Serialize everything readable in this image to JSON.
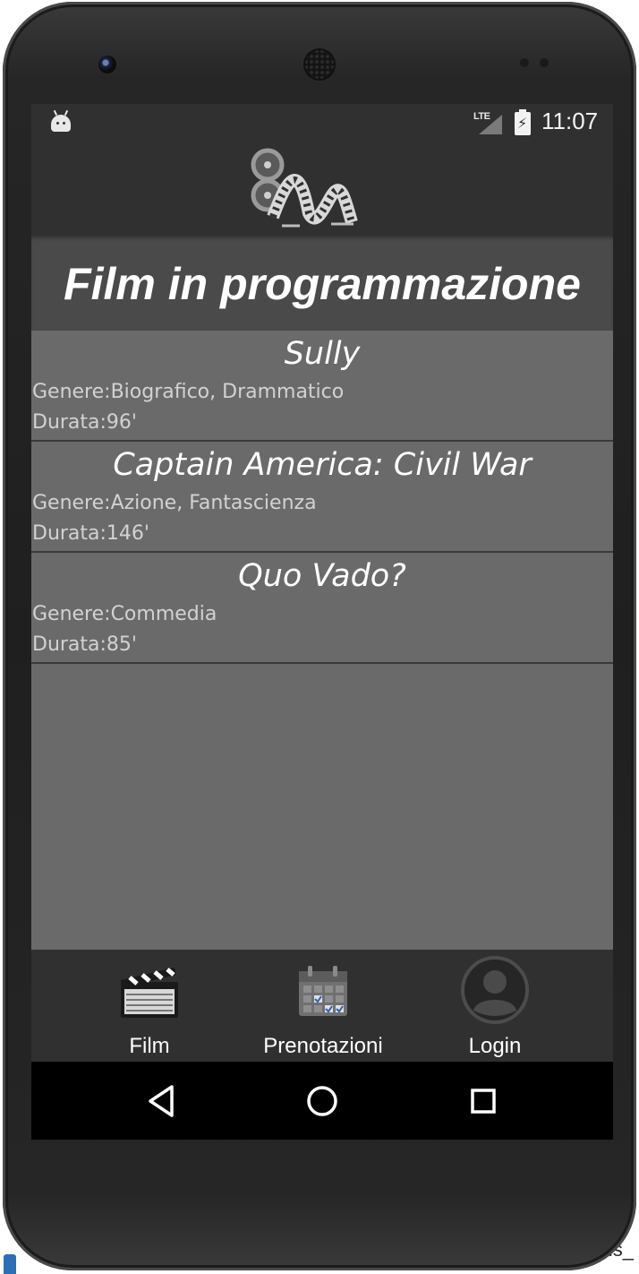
{
  "status_bar": {
    "network": "LTE",
    "time": "11:07",
    "icons": [
      "android-icon",
      "signal-icon",
      "battery-charging-icon"
    ]
  },
  "app": {
    "logo": "film-reel-logo",
    "title": "Film in programmazione"
  },
  "films": [
    {
      "title": "Sully",
      "genre": "Genere:Biografico, Drammatico",
      "duration": "Durata:96'"
    },
    {
      "title": "Captain America: Civil War",
      "genre": "Genere:Azione, Fantascienza",
      "duration": "Durata:146'"
    },
    {
      "title": "Quo Vado?",
      "genre": "Genere:Commedia",
      "duration": "Durata:85'"
    }
  ],
  "bottom_nav": {
    "items": [
      {
        "label": "Film",
        "icon": "clapperboard-icon"
      },
      {
        "label": "Prenotazioni",
        "icon": "calendar-icon"
      },
      {
        "label": "Login",
        "icon": "user-icon"
      }
    ]
  },
  "system_nav": [
    "back-icon",
    "home-icon",
    "recents-icon"
  ],
  "desktop": {
    "device_label": "Nexus_"
  },
  "colors": {
    "bar": "#303030",
    "title_bar": "#4a4a4a",
    "list_background": "#6a6a6a",
    "text": "#ffffff",
    "secondary_text": "#d2d2d2"
  }
}
